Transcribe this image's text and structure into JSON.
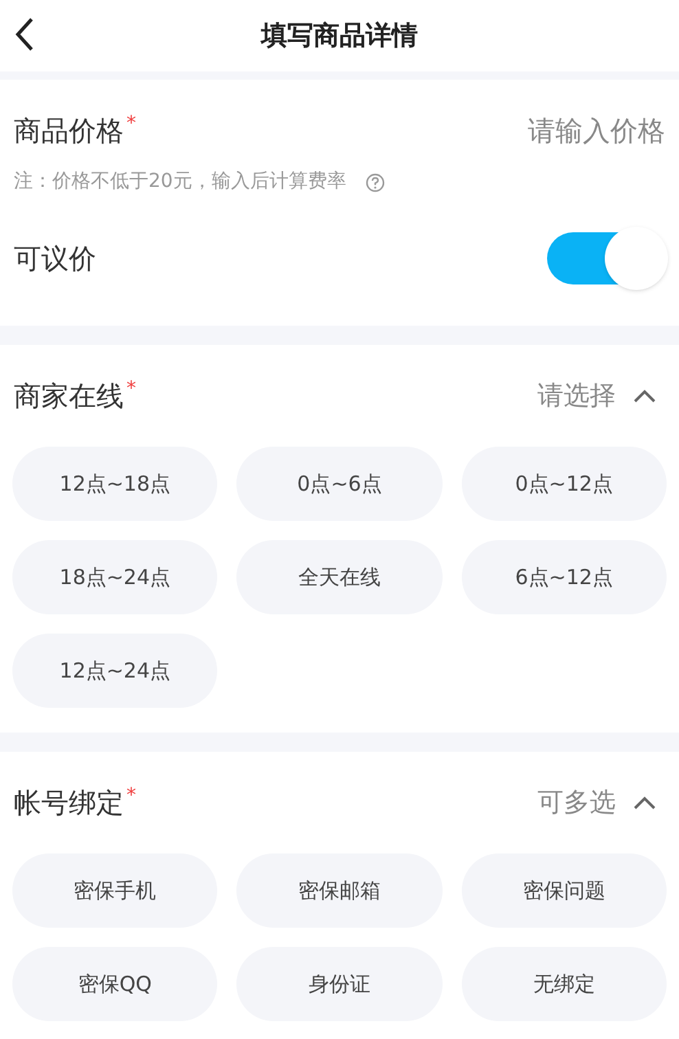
{
  "header": {
    "title": "填写商品详情"
  },
  "price": {
    "label": "商品价格",
    "required_mark": "*",
    "placeholder": "请输入价格",
    "note": "注：价格不低于20元，输入后计算费率"
  },
  "negotiable": {
    "label": "可议价",
    "on": true
  },
  "sections": [
    {
      "label": "商家在线",
      "required_mark": "*",
      "hint": "请选择",
      "expanded": true,
      "options": [
        {
          "label": "12点~18点",
          "selected": false
        },
        {
          "label": "0点~6点",
          "selected": false
        },
        {
          "label": "0点~12点",
          "selected": false
        },
        {
          "label": "18点~24点",
          "selected": false
        },
        {
          "label": "全天在线",
          "selected": false
        },
        {
          "label": "6点~12点",
          "selected": false
        },
        {
          "label": "12点~24点",
          "selected": false
        }
      ]
    },
    {
      "label": "帐号绑定",
      "required_mark": "*",
      "hint": "可多选",
      "expanded": true,
      "options": [
        {
          "label": "密保手机",
          "selected": false
        },
        {
          "label": "密保邮箱",
          "selected": false
        },
        {
          "label": "密保问题",
          "selected": false
        },
        {
          "label": "密保QQ",
          "selected": false
        },
        {
          "label": "身份证",
          "selected": false
        },
        {
          "label": "无绑定",
          "selected": false
        }
      ]
    }
  ]
}
